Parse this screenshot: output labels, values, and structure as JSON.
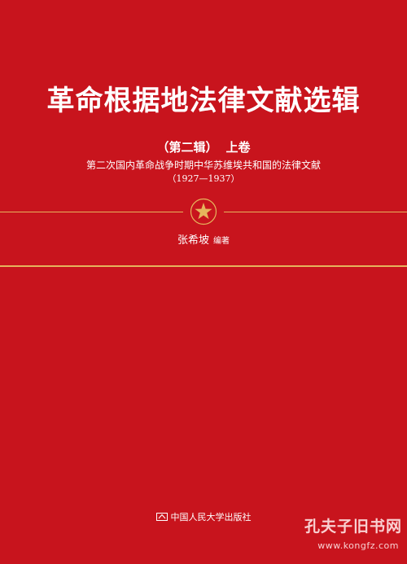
{
  "cover": {
    "background_color": "#c8141d",
    "accent_color": "#e6b45c",
    "title": "革命根据地法律文献选辑",
    "volume_series": "（第二辑）",
    "volume_part": "上卷",
    "subtitle": "第二次国内革命战争时期中华苏维埃共和国的法律文献",
    "years": "（1927—1937）",
    "emblem_icon": "star-emblem-icon",
    "author": "张希坡",
    "author_role": "编著",
    "publisher": "中国人民大学出版社",
    "publisher_logo_icon": "publisher-logo-icon"
  },
  "watermark": {
    "text": "孔夫子旧书网",
    "url": "www.kongfz.com"
  }
}
